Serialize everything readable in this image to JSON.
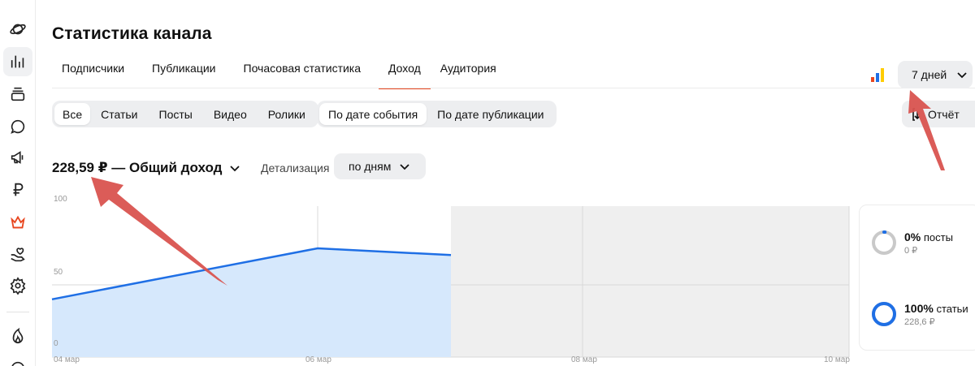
{
  "page": {
    "title": "Статистика канала"
  },
  "tabs": [
    {
      "label": "Подписчики",
      "active": false
    },
    {
      "label": "Публикации",
      "active": false
    },
    {
      "label": "Почасовая статистика",
      "active": false
    },
    {
      "label": "Доход",
      "active": true
    },
    {
      "label": "Аудитория",
      "active": false
    }
  ],
  "period": {
    "label": "7 дней"
  },
  "report": {
    "label": "Отчёт"
  },
  "filters": {
    "type": [
      {
        "label": "Все",
        "active": true
      },
      {
        "label": "Статьи",
        "active": false
      },
      {
        "label": "Посты",
        "active": false
      },
      {
        "label": "Видео",
        "active": false
      },
      {
        "label": "Ролики",
        "active": false
      }
    ],
    "date": [
      {
        "label": "По дате события",
        "active": true
      },
      {
        "label": "По дате публикации",
        "active": false
      }
    ]
  },
  "summary": {
    "total_text": "228,59 ₽ — Общий доход"
  },
  "detail": {
    "label": "Детализация",
    "value": "по дням"
  },
  "chart_data": {
    "type": "area",
    "x_labels": [
      "04 мар",
      "06 мар",
      "08 мар",
      "10 мар"
    ],
    "y_labels": [
      "100",
      "50",
      "0"
    ],
    "ylim": [
      0,
      100
    ],
    "x": [
      "04 мар",
      "05 мар",
      "06 мар",
      "07 мар"
    ],
    "values": [
      40,
      68,
      65
    ],
    "grid": true,
    "color": "#1f6fe5",
    "fill_color": "#d6e8fc",
    "future_shade": "#efefef"
  },
  "stats": [
    {
      "percent": "0%",
      "label": "посты",
      "amount": "0 ₽",
      "ratio": 0.0,
      "color": "#1f6fe5"
    },
    {
      "percent": "100%",
      "label": "статьи",
      "amount": "228,6 ₽",
      "ratio": 1.0,
      "color": "#1f6fe5"
    }
  ],
  "colors": {
    "accent": "#e8461f",
    "annotation": "#d9534f",
    "chip": "#edeef0"
  }
}
